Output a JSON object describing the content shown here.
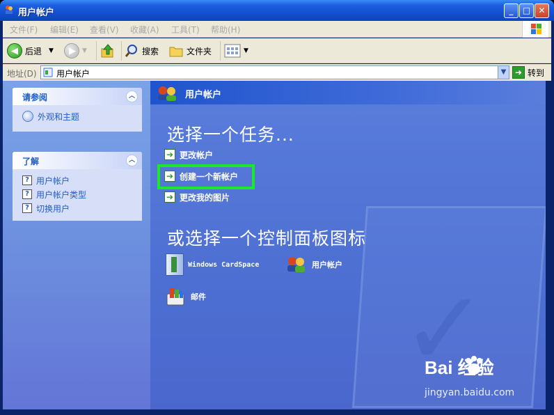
{
  "window": {
    "title": "用户帐户"
  },
  "menubar": {
    "items": [
      "文件(F)",
      "编辑(E)",
      "查看(V)",
      "收藏(A)",
      "工具(T)",
      "帮助(H)"
    ]
  },
  "toolbar": {
    "back_label": "后退",
    "search_label": "搜索",
    "folders_label": "文件夹"
  },
  "address": {
    "label": "地址(D)",
    "value": "用户帐户",
    "go_label": "转到"
  },
  "sidebar": {
    "see_also": {
      "title": "请参阅",
      "items": [
        {
          "label": "外观和主题"
        }
      ]
    },
    "learn_about": {
      "title": "了解",
      "items": [
        {
          "label": "用户帐户"
        },
        {
          "label": "用户帐户类型"
        },
        {
          "label": "切换用户"
        }
      ]
    }
  },
  "content": {
    "header": "用户帐户",
    "task_heading": "选择一个任务...",
    "tasks": [
      {
        "label": "更改帐户"
      },
      {
        "label": "创建一个新帐户"
      },
      {
        "label": "更改我的图片"
      }
    ],
    "cp_heading": "或选择一个控制面板图标",
    "cp_items": [
      {
        "label": "Windows CardSpace"
      },
      {
        "label": "用户帐户"
      },
      {
        "label": "邮件"
      }
    ]
  },
  "watermark": {
    "brand": "Bai 经验",
    "url": "jingyan.baidu.com"
  },
  "colors": {
    "highlight": "#1ee62c",
    "content_bg": "#5a7edc",
    "sidebar_link": "#215dc6"
  }
}
